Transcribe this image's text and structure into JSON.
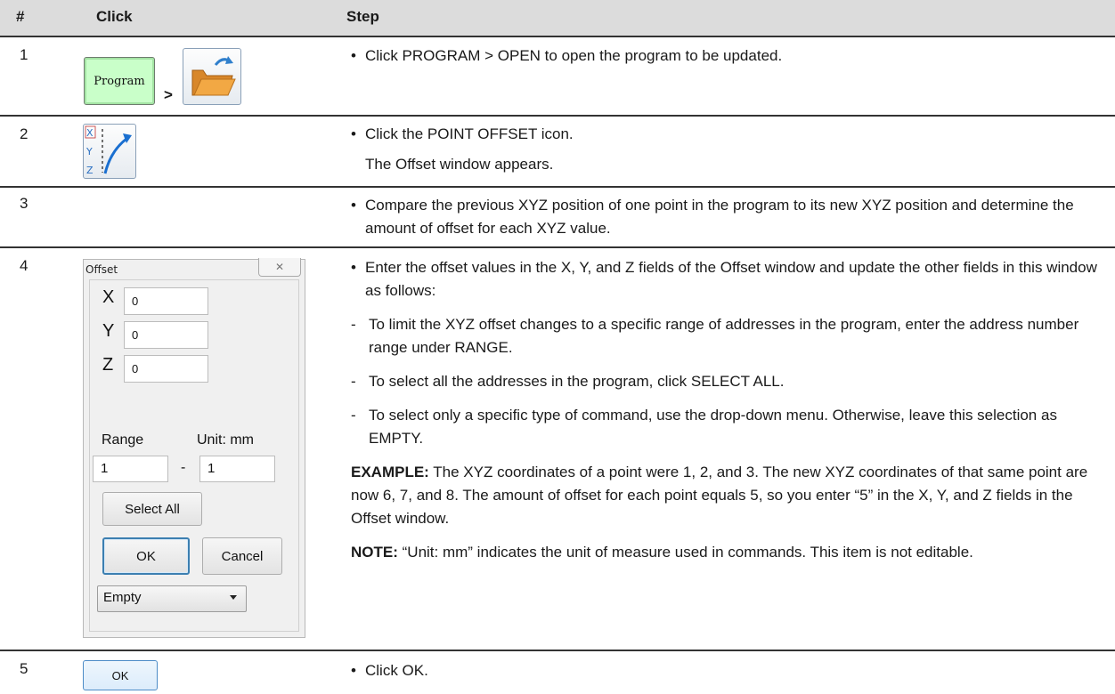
{
  "table": {
    "headers": {
      "num": "#",
      "click": "Click",
      "step": "Step"
    }
  },
  "rows": [
    {
      "num": "1",
      "button_label": "Program",
      "separator": ">",
      "text": "Click PROGRAM > OPEN to open the program to be updated."
    },
    {
      "num": "2",
      "icon_labels": [
        "X",
        "Y",
        "Z"
      ],
      "text": "Click the POINT OFFSET icon.",
      "subtext": "The Offset window appears."
    },
    {
      "num": "3",
      "text": "Compare the previous XYZ position of one point in the program to its new XYZ position and determine the amount of offset for each XYZ value."
    },
    {
      "num": "4",
      "text": "Enter the offset values in the X, Y, and Z fields of the Offset window and update the other fields in this window as follows:",
      "dashes": [
        "To limit the XYZ offset changes to a specific range of addresses in the program, enter the address number range under RANGE.",
        "To select all the addresses in the program, click SELECT ALL.",
        "To select only a specific type of command, use the drop-down menu. Otherwise, leave this selection as EMPTY."
      ],
      "example_label": "EXAMPLE:",
      "example_text": "The XYZ coordinates of a point were 1, 2, and 3. The new XYZ coordinates of that same point are now 6, 7, and 8. The amount of offset for each point equals 5, so you enter “5” in the X, Y, and Z fields in the Offset window.",
      "note_label": "NOTE:",
      "note_text": "“Unit: mm” indicates the unit of measure used in commands. This item is not editable."
    },
    {
      "num": "5",
      "button_label": "OK",
      "text": "Click OK."
    }
  ],
  "offset_dialog": {
    "title": "Offset",
    "close_glyph": "✕",
    "x_label": "X",
    "x_value": "0",
    "y_label": "Y",
    "y_value": "0",
    "z_label": "Z",
    "z_value": "0",
    "range_label": "Range",
    "unit_label": "Unit: mm",
    "range_from": "1",
    "range_dash": "-",
    "range_to": "1",
    "select_all_label": "Select All",
    "ok_label": "OK",
    "cancel_label": "Cancel",
    "command_type_selected": "Empty"
  },
  "bullet_glyph": "•",
  "dash_glyph": "-"
}
